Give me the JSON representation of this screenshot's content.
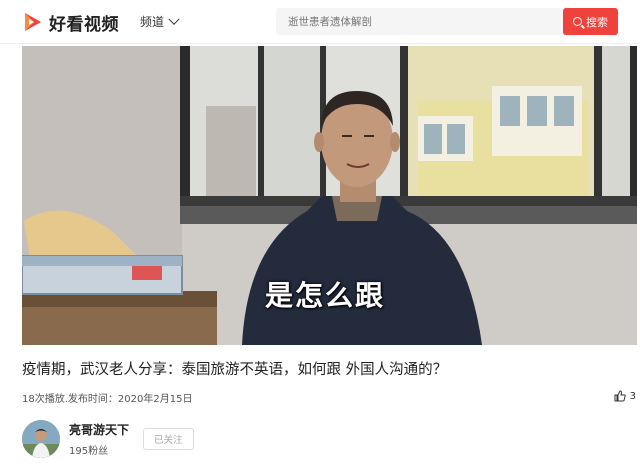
{
  "header": {
    "logo_text": "好看视频",
    "channel_label": "频道",
    "search_placeholder": "逝世患者遗体解剖",
    "search_button": "搜索",
    "brand_color": "#f0423c"
  },
  "video": {
    "caption": "是怎么跟"
  },
  "info": {
    "title": "疫情期，武汉老人分享：泰国旅游不英语，如何跟 外国人沟通的？",
    "meta": "18次播放.发布时间：2020年2月15日",
    "like_count": "3"
  },
  "author": {
    "name": "亮哥游天下",
    "fans": "195粉丝",
    "follow_label": "已关注"
  }
}
